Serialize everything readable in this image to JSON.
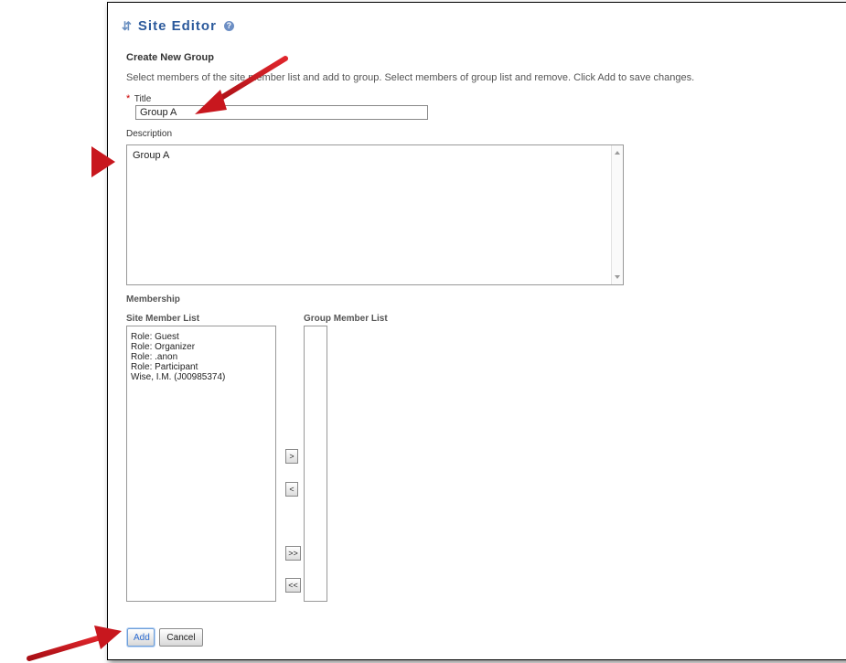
{
  "header": {
    "title": "Site Editor",
    "title_icon": "arrows-icon",
    "help_icon": "help-icon"
  },
  "form": {
    "heading": "Create New Group",
    "instructions": "Select members of the site member list and add to group. Select members of group list and remove. Click Add to save changes.",
    "required_marker": "*",
    "title_label": "Title",
    "title_value": "Group A",
    "description_label": "Description",
    "description_value": "Group A"
  },
  "membership": {
    "heading": "Membership",
    "site_list_label": "Site Member List",
    "group_list_label": "Group Member List",
    "site_members": [
      "Role: Guest",
      "Role: Organizer",
      "Role: .anon",
      "Role: Participant",
      "Wise, I.M. (J00985374)"
    ],
    "group_members": [],
    "buttons": {
      "add_one": ">",
      "remove_one": "<",
      "add_all": ">>",
      "remove_all": "<<"
    }
  },
  "actions": {
    "add_label": "Add",
    "cancel_label": "Cancel"
  },
  "annotations": {
    "arrow_color": "#c8171e"
  },
  "colors": {
    "title_blue": "#2c5a9c",
    "required_red": "#cc0000"
  }
}
